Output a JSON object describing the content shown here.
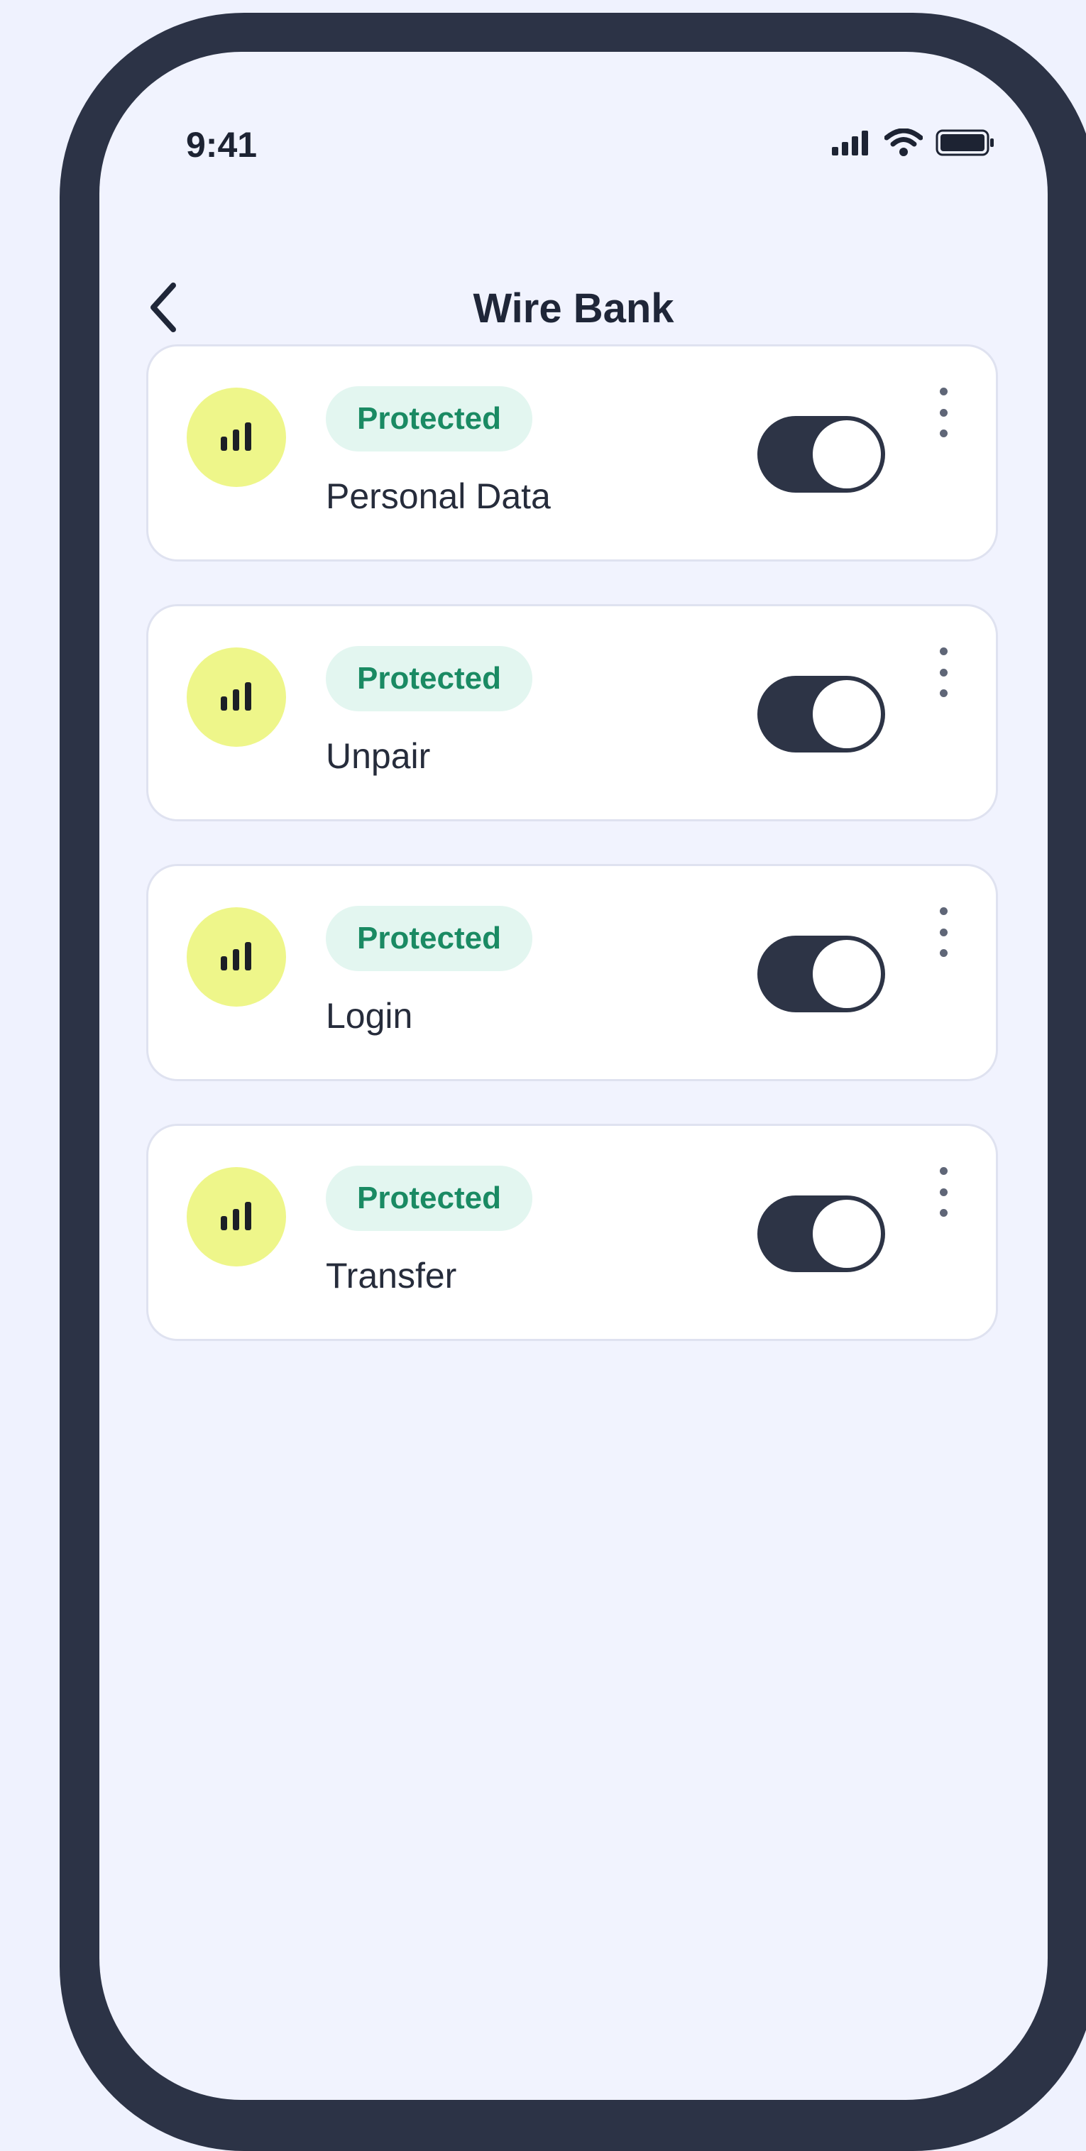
{
  "status_bar": {
    "time": "9:41"
  },
  "header": {
    "title": "Wire Bank"
  },
  "items": [
    {
      "badge": "Protected",
      "label": "Personal Data",
      "enabled": true
    },
    {
      "badge": "Protected",
      "label": "Unpair",
      "enabled": true
    },
    {
      "badge": "Protected",
      "label": "Login",
      "enabled": true
    },
    {
      "badge": "Protected",
      "label": "Transfer",
      "enabled": true
    }
  ],
  "colors": {
    "background": "#eff2fe",
    "frame": "#2c3346",
    "badge_text": "#1a8a63",
    "badge_bg": "#e3f6f0",
    "avatar": "#eef68a",
    "toggle_on": "#2d3446"
  },
  "icons": {
    "back": "chevron-left-icon",
    "avatar": "signal-bars-icon",
    "menu": "more-vertical-icon",
    "status": [
      "cellular-signal-icon",
      "wifi-icon",
      "battery-icon"
    ]
  }
}
